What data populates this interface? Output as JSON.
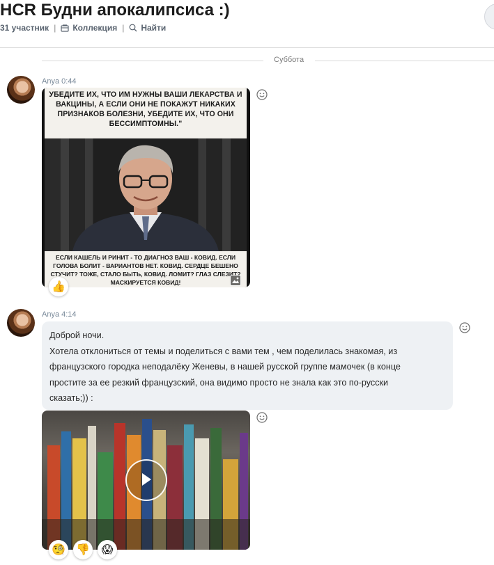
{
  "header": {
    "title": "HCR Будни апокалипсиса :)",
    "participants": "31 участник",
    "separator": "|",
    "collection_label": "Коллекция",
    "search_label": "Найти"
  },
  "day_divider": "Суббота",
  "messages": [
    {
      "author": "Anya 0:44",
      "image_text_top": "УБЕДИТЕ ИХ, ЧТО ИМ НУЖНЫ ВАШИ ЛЕКАРСТВА И ВАКЦИНЫ, А ЕСЛИ ОНИ НЕ ПОКАЖУТ НИКАКИХ ПРИЗНАКОВ БОЛЕЗНИ, УБЕДИТЕ ИХ, ЧТО ОНИ БЕССИМПТОМНЫ.\"",
      "image_text_bottom": "ЕСЛИ КАШЕЛЬ И РИНИТ - ТО ДИАГНОЗ ВАШ - КОВИД. ЕСЛИ ГОЛОВА БОЛИТ - ВАРИАНТОВ НЕТ. КОВИД. СЕРДЦЕ БЕШЕНО СТУЧИТ? ТОЖЕ, СТАЛО БЫТЬ, КОВИД. ЛОМИТ? ГЛАЗ СЛЕЗИТ? МАСКИРУЕТСЯ КОВИД!",
      "reactions": [
        "👍"
      ]
    },
    {
      "author": "Anya 4:14",
      "text_lines": [
        "Доброй ночи.",
        "Хотела отклониться от темы и поделиться с вами тем , чем поделилась знакомая, из",
        "французского городка неподалёку Женевы, в нашей русской группе мамочек (в конце",
        "простите за ее резкий французский, она видимо просто не знала как это по-русски",
        "сказать;)) :"
      ],
      "reactions": [
        "🧐",
        "👎",
        "😱"
      ]
    }
  ],
  "colors": {
    "accent_red": "#b81c1c",
    "bubble_bg": "#eef1f4",
    "meta_text": "#7a8a9a"
  },
  "icons": [
    "collection-icon",
    "search-icon",
    "emoji-icon",
    "play-icon",
    "gallery-icon"
  ]
}
